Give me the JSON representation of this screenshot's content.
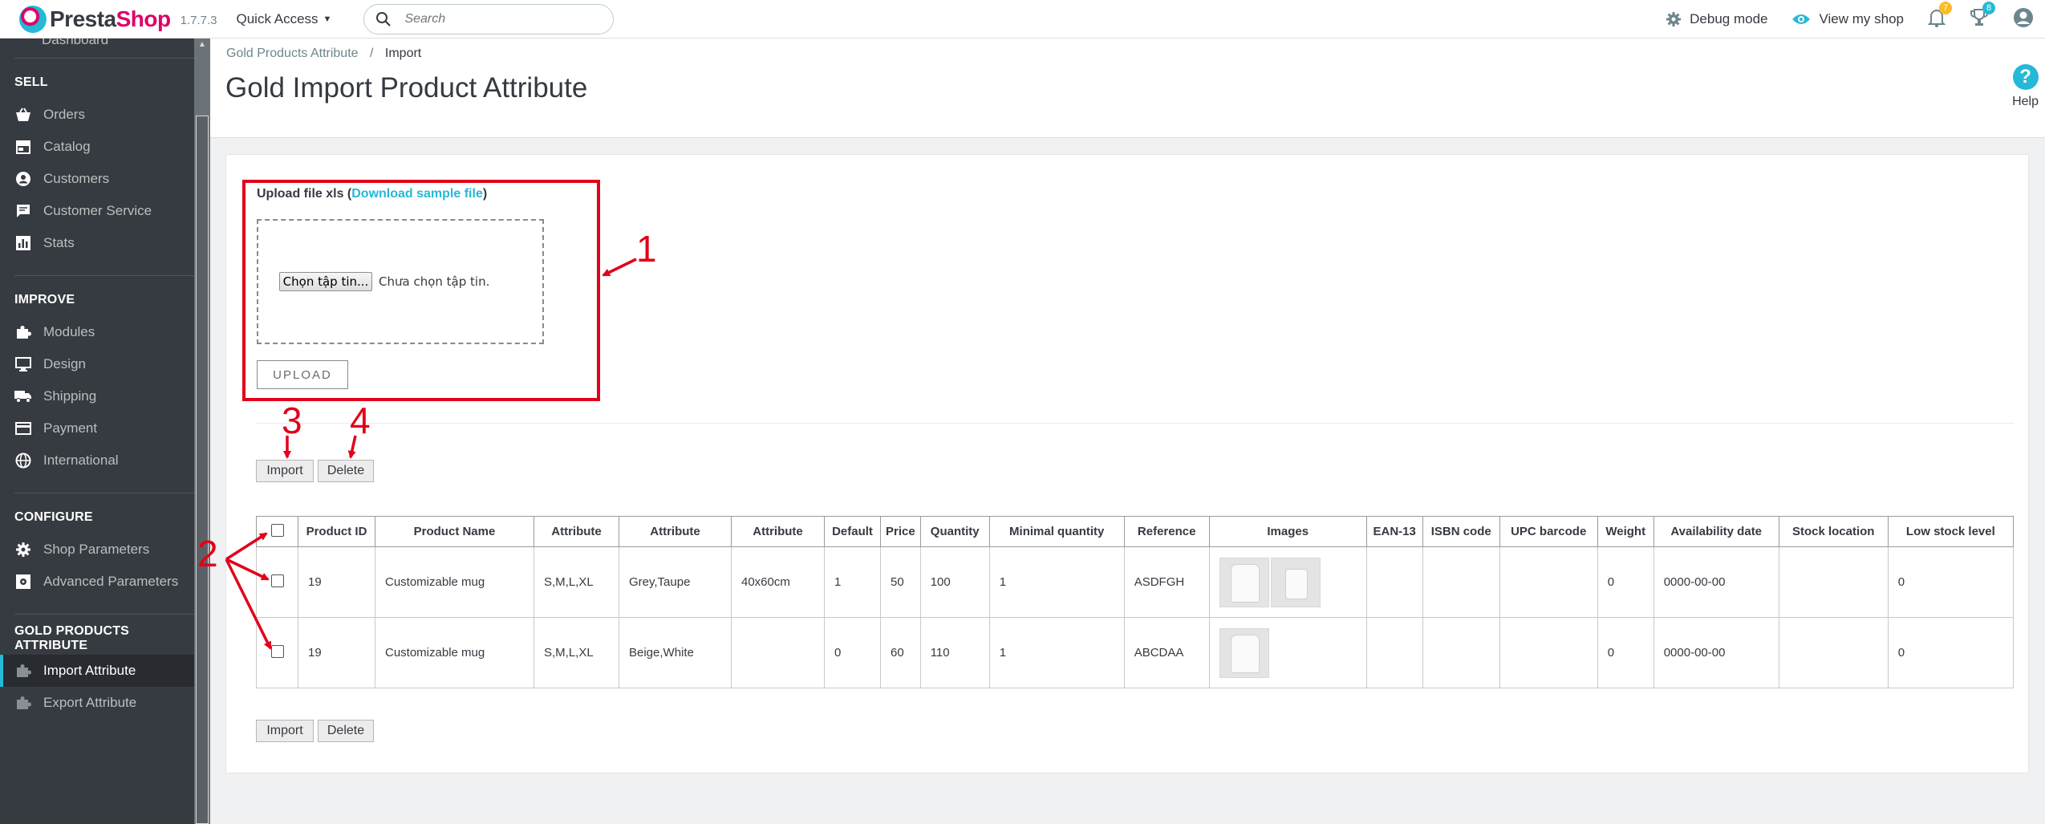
{
  "header": {
    "logo_pre": "Presta",
    "logo_post": "Shop",
    "version": "1.7.7.3",
    "quick_access": "Quick Access",
    "search_placeholder": "Search",
    "debug_mode": "Debug mode",
    "view_shop": "View my shop",
    "notif_count": "7",
    "orders_count": "8"
  },
  "sidebar": {
    "top_partial": "Dashboard",
    "sections": [
      {
        "title": "SELL",
        "items": [
          "Orders",
          "Catalog",
          "Customers",
          "Customer Service",
          "Stats"
        ]
      },
      {
        "title": "IMPROVE",
        "items": [
          "Modules",
          "Design",
          "Shipping",
          "Payment",
          "International"
        ]
      },
      {
        "title": "CONFIGURE",
        "items": [
          "Shop Parameters",
          "Advanced Parameters"
        ]
      },
      {
        "title": "GOLD PRODUCTS ATTRIBUTE",
        "items": [
          "Import Attribute",
          "Export Attribute"
        ]
      }
    ]
  },
  "breadcrumb": {
    "parent": "Gold Products Attribute",
    "separator": "/",
    "current": "Import"
  },
  "page_title": "Gold Import Product Attribute",
  "help_label": "Help",
  "upload": {
    "label_prefix": "Upload file xls (",
    "sample_link": "Download sample file",
    "label_suffix": ")",
    "choose_file": "Chọn tập tin...",
    "no_file": "Chưa chọn tập tin.",
    "upload_button": "UPLOAD"
  },
  "actions": {
    "import": "Import",
    "delete": "Delete"
  },
  "table": {
    "columns": [
      "",
      "Product ID",
      "Product Name",
      "Attribute",
      "Attribute",
      "Attribute",
      "Default",
      "Price",
      "Quantity",
      "Minimal quantity",
      "Reference",
      "Images",
      "EAN-13",
      "ISBN code",
      "UPC barcode",
      "Weight",
      "Availability date",
      "Stock location",
      "Low stock level"
    ],
    "rows": [
      {
        "product_id": "19",
        "product_name": "Customizable mug",
        "attr1": "S,M,L,XL",
        "attr2": "Grey,Taupe",
        "attr3": "40x60cm",
        "default": "1",
        "price": "50",
        "quantity": "100",
        "min_qty": "1",
        "reference": "ASDFGH",
        "images": 2,
        "ean13": "",
        "isbn": "",
        "upc": "",
        "weight": "0",
        "availability": "0000-00-00",
        "stock_location": "",
        "low_stock": "0"
      },
      {
        "product_id": "19",
        "product_name": "Customizable mug",
        "attr1": "S,M,L,XL",
        "attr2": "Beige,White",
        "attr3": "",
        "default": "0",
        "price": "60",
        "quantity": "110",
        "min_qty": "1",
        "reference": "ABCDAA",
        "images": 1,
        "ean13": "",
        "isbn": "",
        "upc": "",
        "weight": "0",
        "availability": "0000-00-00",
        "stock_location": "",
        "low_stock": "0"
      }
    ]
  },
  "annotations": [
    "1",
    "2",
    "3",
    "4"
  ],
  "colors": {
    "accent": "#25b9d7",
    "brand_pink": "#df0067",
    "sidebar": "#363a41",
    "annotation_red": "#e2001a"
  }
}
